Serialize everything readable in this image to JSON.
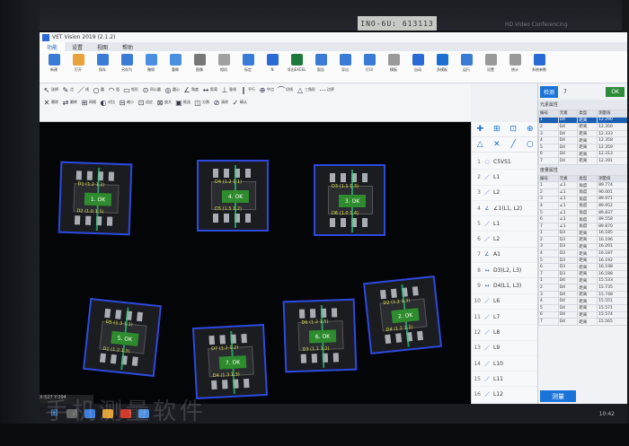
{
  "window": {
    "title": "VET Vision 2019 (2.1.2)"
  },
  "serial_label": "INO-6U: 613113",
  "monitor_label": "HD Video Conferencing",
  "menu_tabs": [
    "功能",
    "设置",
    "视图",
    "帮助"
  ],
  "ribbon": [
    {
      "label": "新建",
      "color": "#3a7bd5"
    },
    {
      "label": "打开",
      "color": "#e8a23a"
    },
    {
      "label": "保存",
      "color": "#3a7bd5"
    },
    {
      "label": "另存为",
      "color": "#3a7bd5"
    },
    {
      "label": "撤销",
      "color": "#4a8fe0"
    },
    {
      "label": "重做",
      "color": "#4a8fe0"
    },
    {
      "label": "图像",
      "color": "#777777"
    },
    {
      "label": "相机",
      "color": "#a0a0a0"
    },
    {
      "label": "标定",
      "color": "#3a7bd5"
    },
    {
      "label": "N",
      "color": "#2a6ad4"
    },
    {
      "label": "导出EXCEL",
      "color": "#1e7a3c"
    },
    {
      "label": "报告",
      "color": "#3a7bd5"
    },
    {
      "label": "导出",
      "color": "#3a7bd5"
    },
    {
      "label": "打印",
      "color": "#3a7bd5"
    },
    {
      "label": "模板",
      "color": "#999999"
    },
    {
      "label": "自动",
      "color": "#2a6ad4"
    },
    {
      "label": "多模板",
      "color": "#1a6fd0"
    },
    {
      "label": "运行",
      "color": "#3a7bd5"
    },
    {
      "label": "设置",
      "color": "#999999"
    },
    {
      "label": "统计",
      "color": "#999999"
    },
    {
      "label": "系统参数",
      "color": "#2a6ad4"
    }
  ],
  "tools_row1": [
    {
      "g": "↖",
      "t": "选择"
    },
    {
      "g": "✎",
      "t": "点"
    },
    {
      "g": "／",
      "t": "线"
    },
    {
      "g": "○",
      "t": "圆"
    },
    {
      "g": "◠",
      "t": "弧"
    },
    {
      "g": "▭",
      "t": "矩形"
    },
    {
      "g": "⊙",
      "t": "同心圆"
    },
    {
      "g": "◎",
      "t": "圆心"
    },
    {
      "g": "∠",
      "t": "角度"
    },
    {
      "g": "↔",
      "t": "距离"
    },
    {
      "g": "⊥",
      "t": "垂线"
    },
    {
      "g": "∥",
      "t": "平行"
    },
    {
      "g": "⊕",
      "t": "中点"
    },
    {
      "g": "⌒",
      "t": "切线"
    },
    {
      "g": "△",
      "t": "三角形"
    },
    {
      "g": "⋯",
      "t": "边界"
    }
  ],
  "tools_row2": [
    {
      "g": "✕",
      "t": "删除"
    },
    {
      "g": "⇄",
      "t": "翻转"
    },
    {
      "g": "⊞",
      "t": "网格"
    },
    {
      "g": "◐",
      "t": "对比"
    },
    {
      "g": "⊟",
      "t": "缩小"
    },
    {
      "g": "⊡",
      "t": "适应"
    },
    {
      "g": "⊠",
      "t": "放大"
    },
    {
      "g": "▣",
      "t": "框选"
    },
    {
      "g": "◫",
      "t": "分割"
    },
    {
      "g": "⊘",
      "t": "清除"
    },
    {
      "g": "✓",
      "t": "确认"
    }
  ],
  "chips": [
    {
      "label": "1. OK",
      "dim": "D1 (1.2 1.2)",
      "dim2": "D2 (1.0 1.5)"
    },
    {
      "label": "4. OK",
      "dim": "D4 (1.2 1.1)",
      "dim2": "D5 (1.5 1.2)"
    },
    {
      "label": "3. OK",
      "dim": "D3 (1.1 1.3)",
      "dim2": "D6 (1.0 1.4)"
    },
    {
      "label": "2. OK",
      "dim": "D2 (1.2 1.3)",
      "dim2": "D4 (1.2 1.2)"
    },
    {
      "label": "5. OK",
      "dim": "D5 (1.3 1.1)",
      "dim2": "D1 (1.2 1.3)"
    },
    {
      "label": "7. OK",
      "dim": "D7 (1.2 1.2)",
      "dim2": "D4 (1.3 1.3)"
    },
    {
      "label": "6. OK",
      "dim": "D6 (1.2 1.5)",
      "dim2": "D3 (1.1 1.2)"
    }
  ],
  "status_text": "X:527 Y:394",
  "feature_list": [
    {
      "n": "1",
      "g": "◌",
      "t": "C5VS1"
    },
    {
      "n": "2",
      "g": "／",
      "t": "L1"
    },
    {
      "n": "3",
      "g": "／",
      "t": "L2"
    },
    {
      "n": "4",
      "g": "∠",
      "t": "∠1(L1, L2)"
    },
    {
      "n": "5",
      "g": "／",
      "t": "L1"
    },
    {
      "n": "6",
      "g": "／",
      "t": "L2"
    },
    {
      "n": "7",
      "g": "∠",
      "t": "A1"
    },
    {
      "n": "8",
      "g": "↔",
      "t": "D3(L2, L3)"
    },
    {
      "n": "9",
      "g": "↔",
      "t": "D4(L1, L3)"
    },
    {
      "n": "10",
      "g": "／",
      "t": "L6"
    },
    {
      "n": "11",
      "g": "／",
      "t": "L7"
    },
    {
      "n": "12",
      "g": "／",
      "t": "L8"
    },
    {
      "n": "13",
      "g": "／",
      "t": "L9"
    },
    {
      "n": "14",
      "g": "／",
      "t": "L10"
    },
    {
      "n": "15",
      "g": "／",
      "t": "L11"
    },
    {
      "n": "16",
      "g": "／",
      "t": "L12"
    },
    {
      "n": "17",
      "g": "↔",
      "t": "D2(L6, L10)"
    }
  ],
  "right_panel": {
    "run_button": "检测",
    "count": "7",
    "ok_label": "OK",
    "section1_title": "元素属性",
    "table1_header": [
      "编号",
      "元素",
      "类型",
      "测量值"
    ],
    "table1_rows": [
      [
        "1",
        "D4",
        "距离",
        "12.290"
      ],
      [
        "2",
        "D4",
        "距离",
        "12.350"
      ],
      [
        "3",
        "D4",
        "距离",
        "12.333"
      ],
      [
        "4",
        "D4",
        "距离",
        "12.358"
      ],
      [
        "5",
        "D4",
        "距离",
        "12.359"
      ],
      [
        "6",
        "D4",
        "距离",
        "12.313"
      ],
      [
        "7",
        "D4",
        "距离",
        "12.291"
      ]
    ],
    "section2_title": "度量属性",
    "table2_header": [
      "编号",
      "元素",
      "类型",
      "测量值"
    ],
    "table2_rows": [
      [
        "1",
        "∠1",
        "角度",
        "89.774"
      ],
      [
        "2",
        "∠1",
        "角度",
        "90.001"
      ],
      [
        "3",
        "∠1",
        "角度",
        "89.971"
      ],
      [
        "4",
        "∠1",
        "角度",
        "89.952"
      ],
      [
        "5",
        "∠1",
        "角度",
        "89.837"
      ],
      [
        "6",
        "∠1",
        "角度",
        "89.558"
      ],
      [
        "7",
        "∠1",
        "角度",
        "89.870"
      ],
      [
        "1",
        "D3",
        "距离",
        "16.185"
      ],
      [
        "2",
        "D3",
        "距离",
        "16.196"
      ],
      [
        "3",
        "D3",
        "距离",
        "16.201"
      ],
      [
        "4",
        "D3",
        "距离",
        "16.187"
      ],
      [
        "5",
        "D3",
        "距离",
        "16.192"
      ],
      [
        "6",
        "D3",
        "距离",
        "16.198"
      ],
      [
        "7",
        "D3",
        "距离",
        "16.188"
      ],
      [
        "1",
        "D4",
        "距离",
        "15.533"
      ],
      [
        "2",
        "D4",
        "距离",
        "15.735"
      ],
      [
        "3",
        "D4",
        "距离",
        "15.748"
      ],
      [
        "4",
        "D4",
        "距离",
        "15.551"
      ],
      [
        "5",
        "D4",
        "距离",
        "15.571"
      ],
      [
        "6",
        "D4",
        "距离",
        "15.574"
      ],
      [
        "7",
        "D4",
        "距离",
        "15.565"
      ]
    ],
    "measure_button": "测量"
  },
  "watermark": "手机测量软件",
  "taskbar_right": "10:42"
}
